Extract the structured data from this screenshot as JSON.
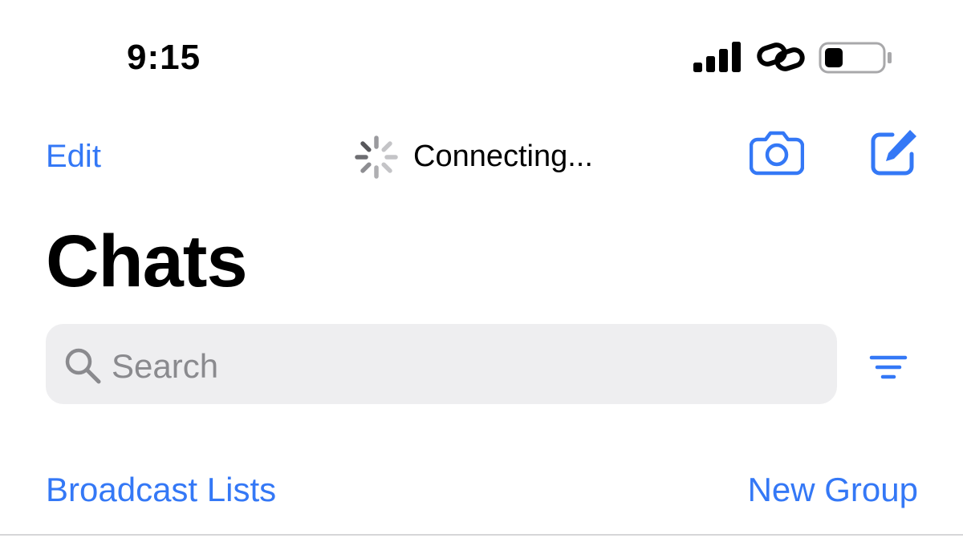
{
  "status_bar": {
    "time": "9:15",
    "signal_icon": "cellular-signal-icon",
    "link_icon": "personal-hotspot-link-icon",
    "battery_icon": "battery-low-icon",
    "battery_level": 0.3
  },
  "nav": {
    "edit_label": "Edit",
    "status_text": "Connecting...",
    "spinner_icon": "loading-spinner-icon",
    "camera_icon": "camera-icon",
    "compose_icon": "compose-icon"
  },
  "page": {
    "title": "Chats"
  },
  "search": {
    "placeholder": "Search",
    "icon": "search-icon",
    "filter_icon": "filter-icon"
  },
  "links": {
    "broadcast_lists": "Broadcast Lists",
    "new_group": "New Group"
  },
  "colors": {
    "accent": "#3478F6",
    "search_bg": "#EEEEF0",
    "placeholder": "#8A8A8E"
  }
}
